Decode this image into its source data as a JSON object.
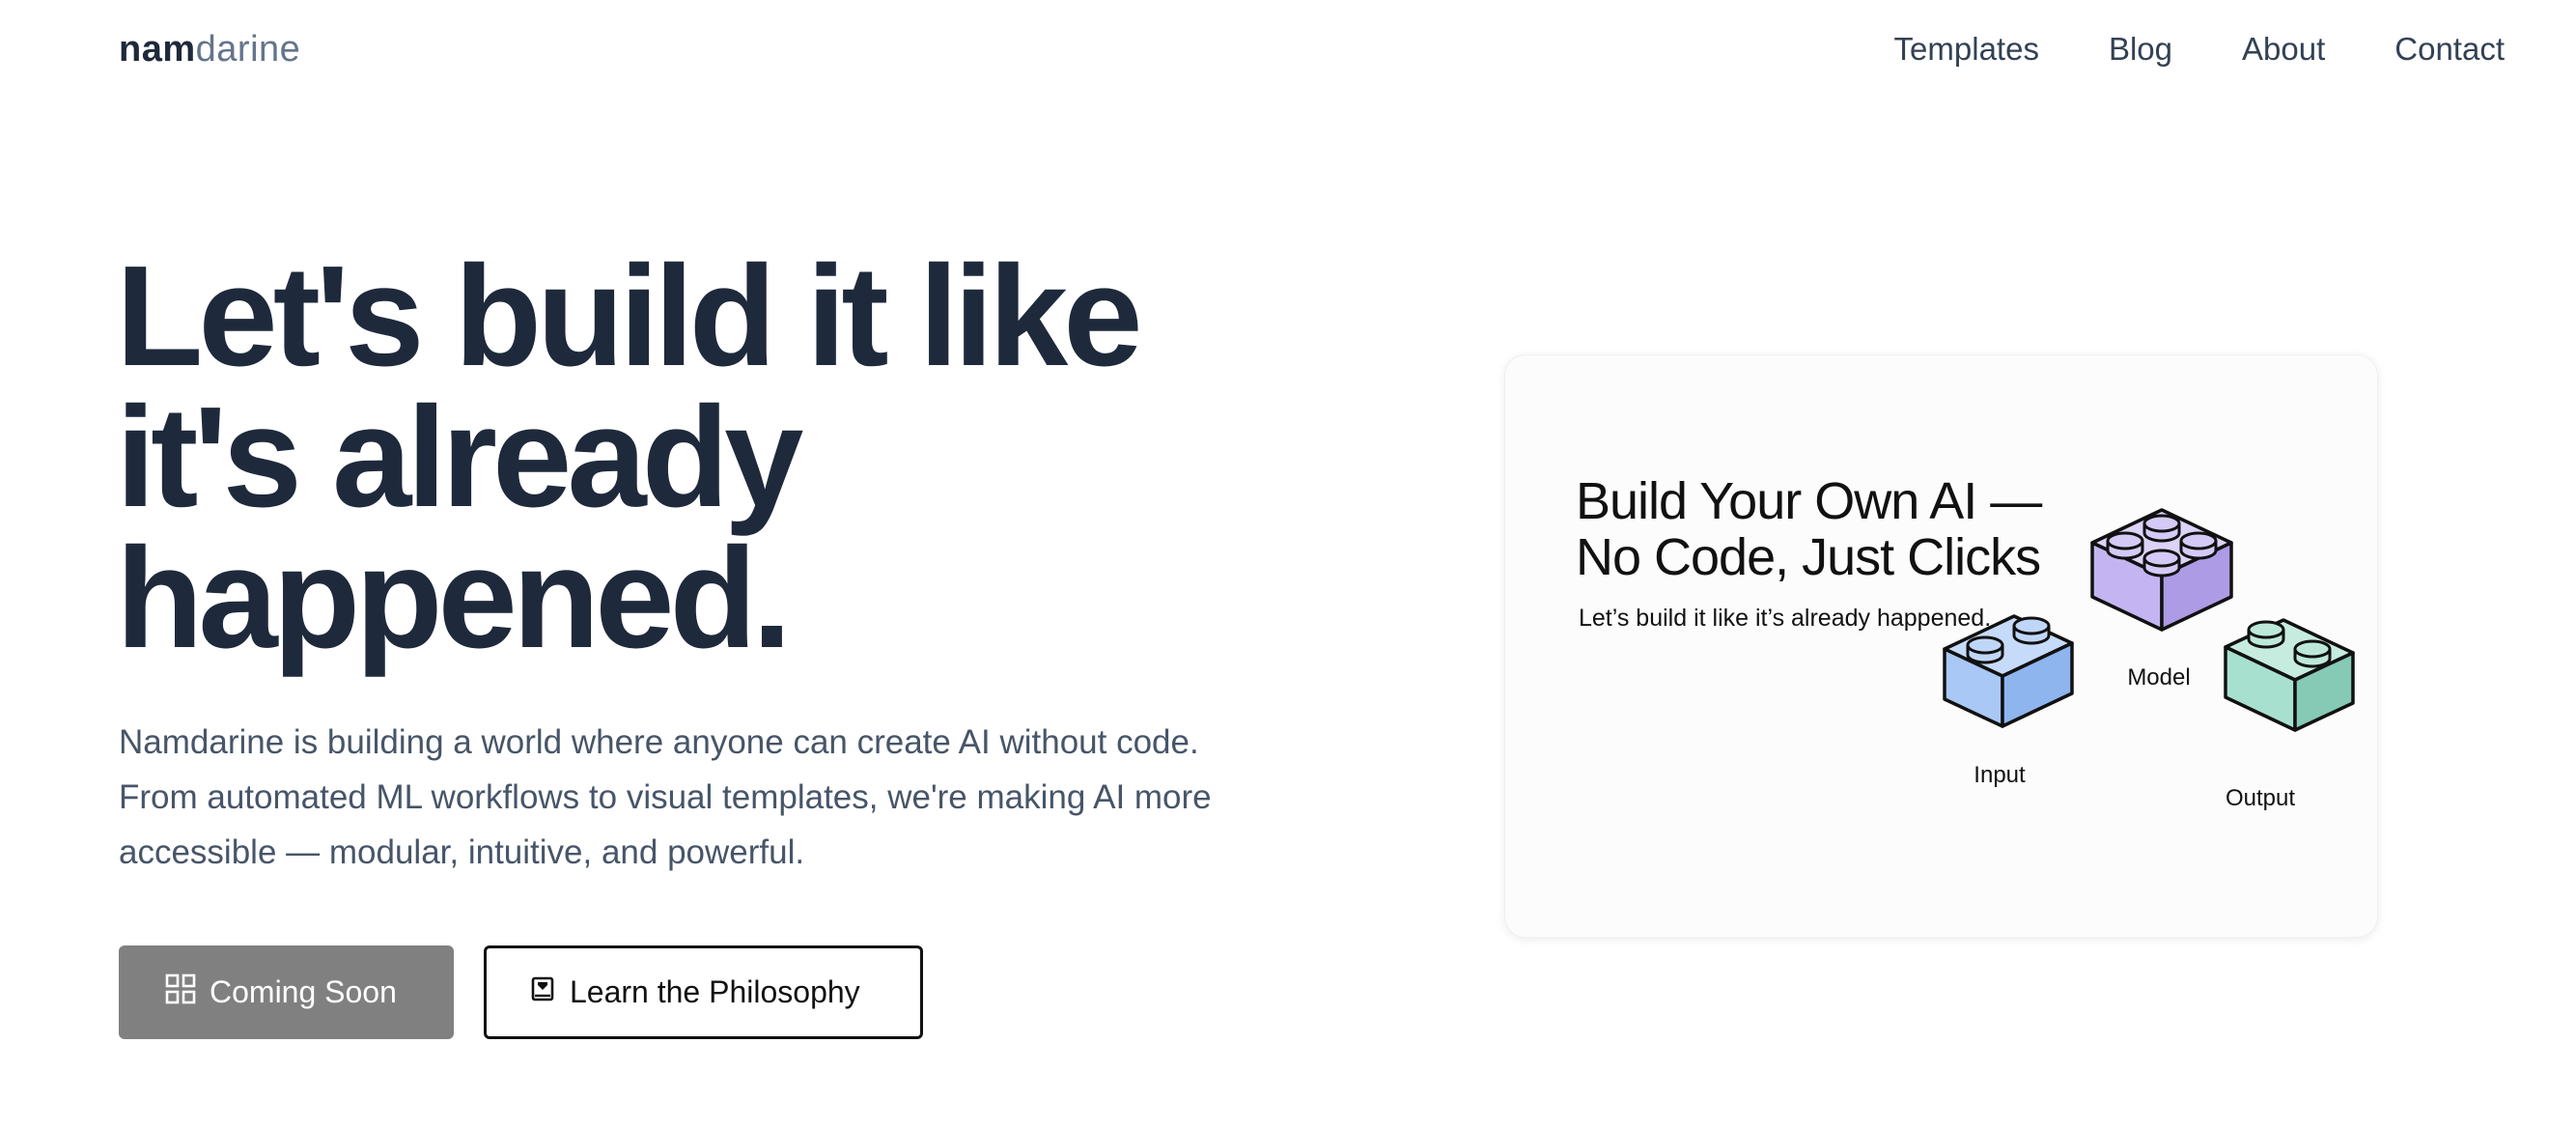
{
  "nav": {
    "logo_bold": "nam",
    "logo_light": "darine",
    "links": [
      "Templates",
      "Blog",
      "About",
      "Contact"
    ]
  },
  "hero": {
    "title_lines": [
      "Let's build it like",
      "it's already",
      "happened."
    ],
    "description": "Namdarine is building a world where anyone can create AI without code. From automated ML workflows to visual templates, we're making AI more accessible — modular, intuitive, and powerful.",
    "buttons": {
      "coming_soon": "Coming Soon",
      "coming_soon_icon": "grid-icon",
      "philosophy": "Learn the Philosophy",
      "philosophy_icon": "book-icon"
    }
  },
  "card": {
    "title_lines": [
      "Build Your Own AI —",
      "No Code, Just Clicks"
    ],
    "subtitle": "Let’s build it like it’s already happened.",
    "blocks": [
      {
        "label": "Model",
        "color": "#c4b5f2"
      },
      {
        "label": "Input",
        "color": "#a9c8f5"
      },
      {
        "label": "Output",
        "color": "#a8e0cf"
      }
    ]
  },
  "colors": {
    "heading": "#1e293b",
    "body_text": "#475569",
    "coming_soon_bg": "#808080",
    "philosophy_border": "#111111"
  }
}
